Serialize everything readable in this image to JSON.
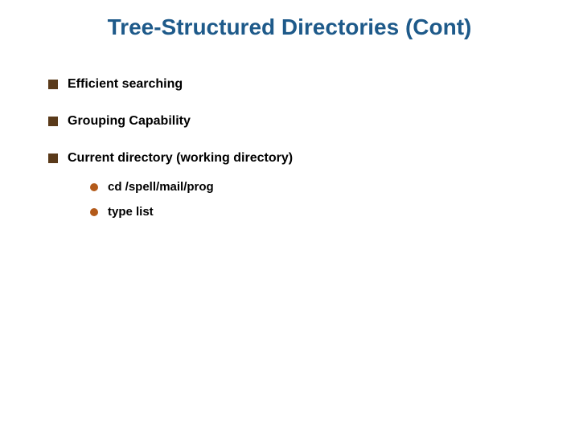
{
  "title": "Tree-Structured Directories (Cont)",
  "bullets": [
    {
      "text": "Efficient searching",
      "sub": []
    },
    {
      "text": "Grouping Capability",
      "sub": []
    },
    {
      "text": "Current directory (working directory)",
      "sub": [
        {
          "text": "cd /spell/mail/prog"
        },
        {
          "text": "type list"
        }
      ]
    }
  ]
}
